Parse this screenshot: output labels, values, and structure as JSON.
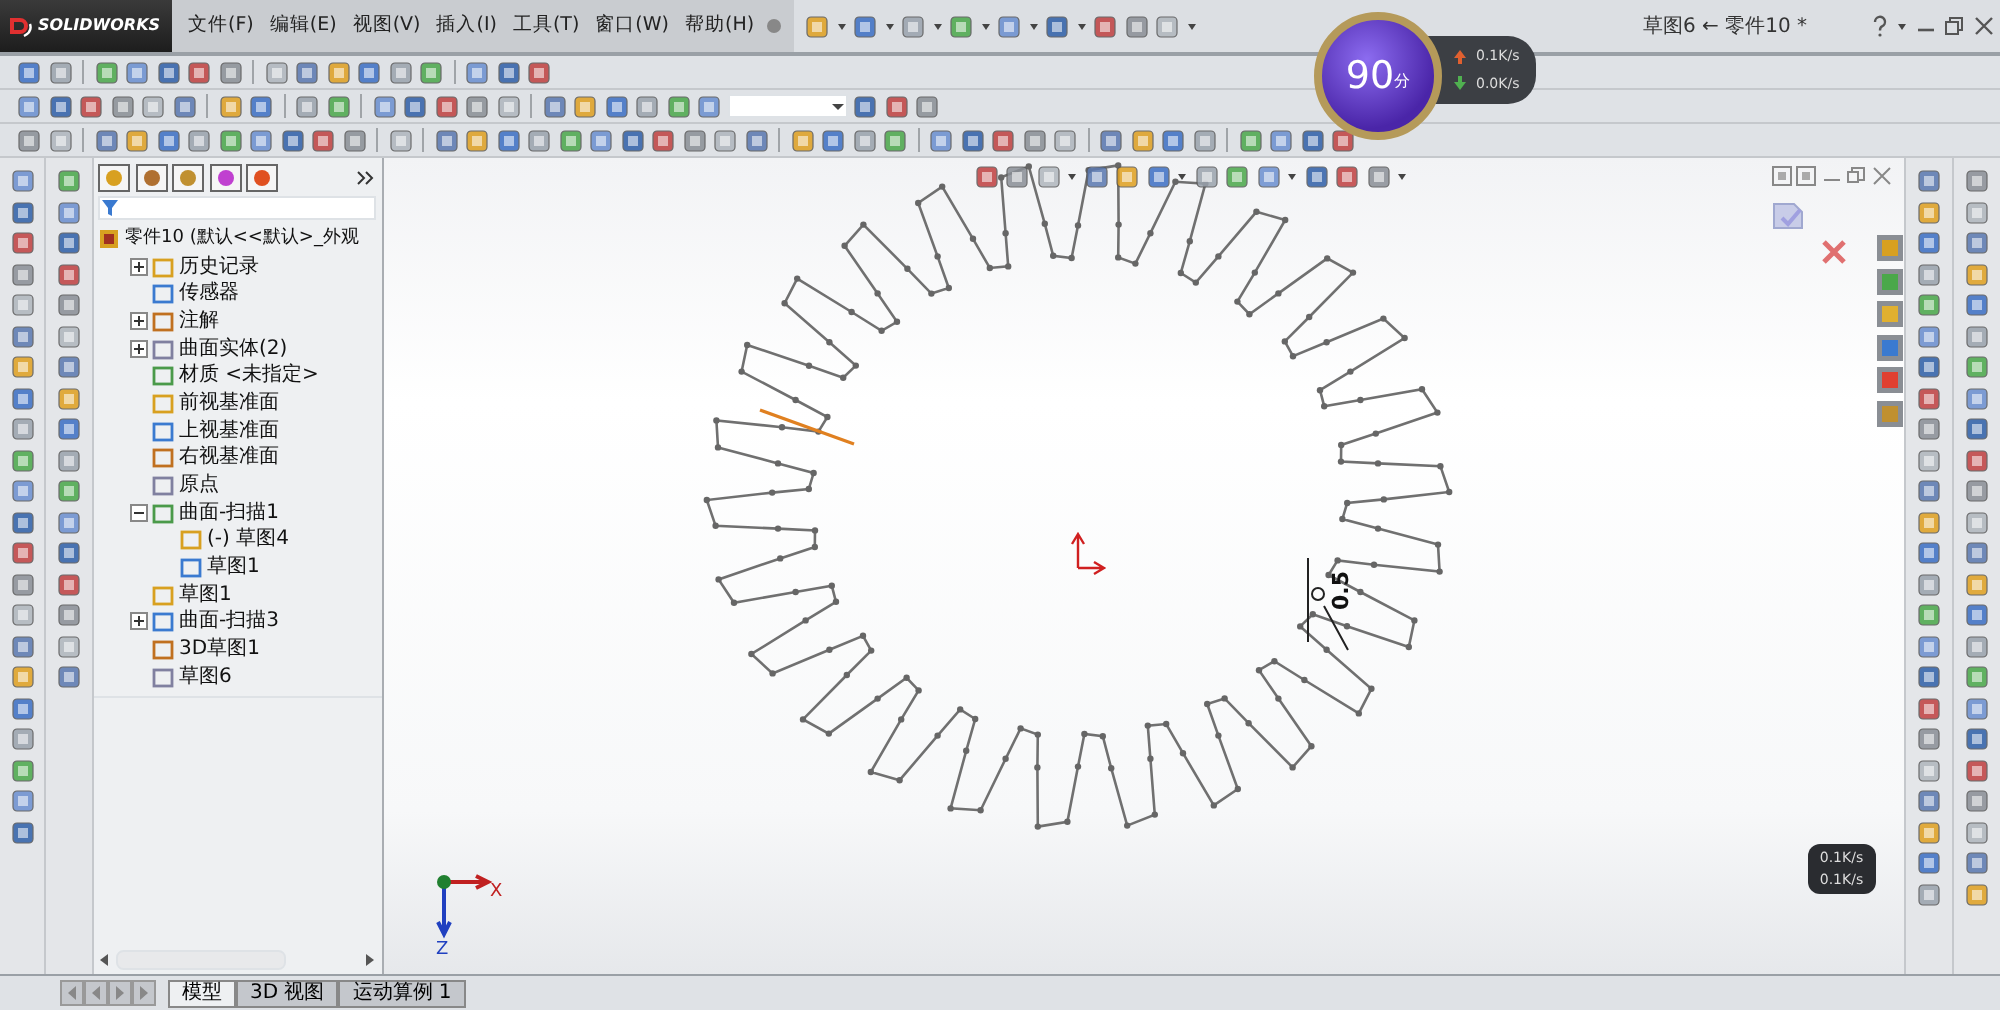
{
  "logo": "SOLIDWORKS",
  "menu": [
    "文件(F)",
    "编辑(E)",
    "视图(V)",
    "插入(I)",
    "工具(T)",
    "窗口(W)",
    "帮助(H)"
  ],
  "title": "草图6 ← 零件10 *",
  "tree": {
    "root": "零件10  (默认<<默认>_外观",
    "items": [
      {
        "label": "历史记录",
        "expanded": false
      },
      {
        "label": "传感器"
      },
      {
        "label": "注解",
        "expanded": false
      },
      {
        "label": "曲面实体(2)",
        "expanded": false
      },
      {
        "label": "材质 <未指定>"
      },
      {
        "label": "前视基准面"
      },
      {
        "label": "上视基准面"
      },
      {
        "label": "右视基准面"
      },
      {
        "label": "原点"
      },
      {
        "label": "曲面-扫描1",
        "expanded": true,
        "children": [
          {
            "label": "(-) 草图4"
          },
          {
            "label": "草图1"
          }
        ]
      },
      {
        "label": "草图1"
      },
      {
        "label": "曲面-扫描3",
        "expanded": false
      },
      {
        "label": "3D草图1"
      },
      {
        "label": "草图6"
      }
    ]
  },
  "canvas": {
    "axis_labels": [
      "X",
      "Z"
    ],
    "dimension": "0.5"
  },
  "bottom_tabs": [
    {
      "label": "模型",
      "selected": true
    },
    {
      "label": "3D 视图",
      "selected": false
    },
    {
      "label": "运动算例 1",
      "selected": false
    }
  ],
  "speed_widget": {
    "score": "90",
    "unit": "分",
    "upload": "0.1K/s",
    "download": "0.0K/s"
  },
  "mini_speed": [
    "0.1K/s",
    "0.1K/s"
  ]
}
